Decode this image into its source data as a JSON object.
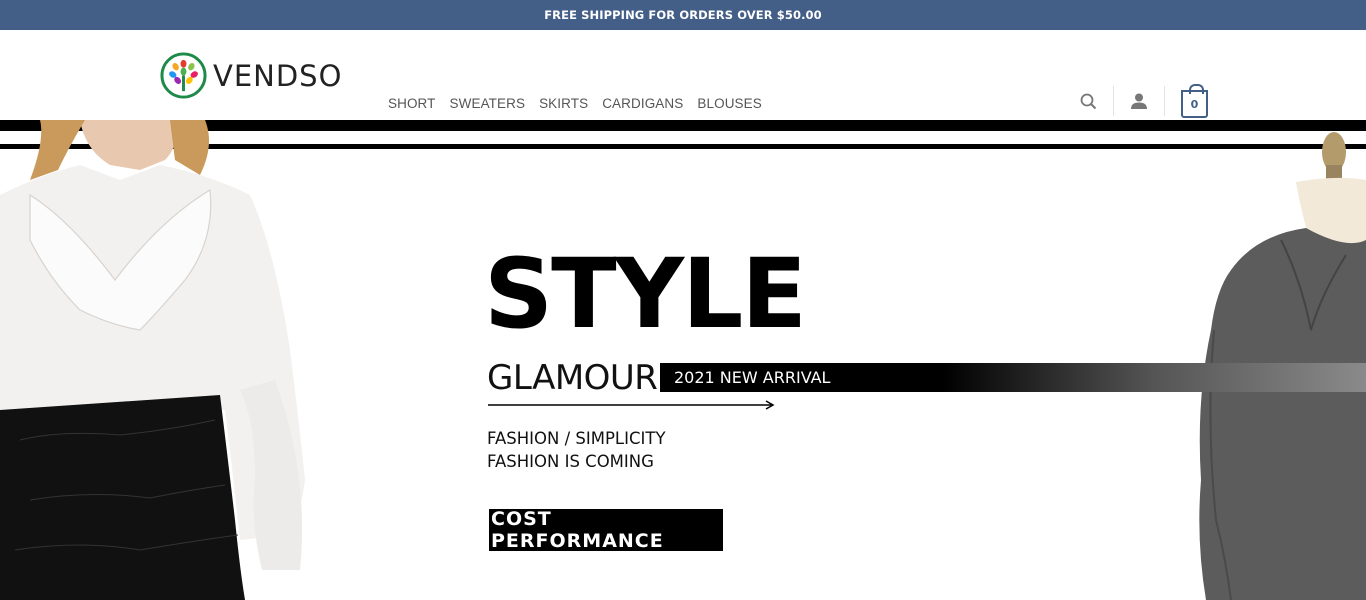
{
  "announcement": {
    "text": "FREE SHIPPING FOR ORDERS OVER $50.00"
  },
  "brand": {
    "name": "VENDSO"
  },
  "nav": {
    "items": [
      {
        "label": "SHORT"
      },
      {
        "label": "SWEATERS"
      },
      {
        "label": "SKIRTS"
      },
      {
        "label": "CARDIGANS"
      },
      {
        "label": "BLOUSES"
      }
    ]
  },
  "header_icons": {
    "search": "search-icon",
    "account": "user-icon",
    "cart": "cart-icon"
  },
  "cart": {
    "count": "0"
  },
  "hero": {
    "title": "STYLE",
    "subtitle": "GLAMOUR",
    "badge": "2021 NEW ARRIVAL",
    "line1": "FASHION / SIMPLICITY",
    "line2": "FASHION IS COMING",
    "cta": "COST PERFORMANCE"
  },
  "colors": {
    "accent": "#435f88",
    "text": "#555555",
    "hero_black": "#000000"
  }
}
